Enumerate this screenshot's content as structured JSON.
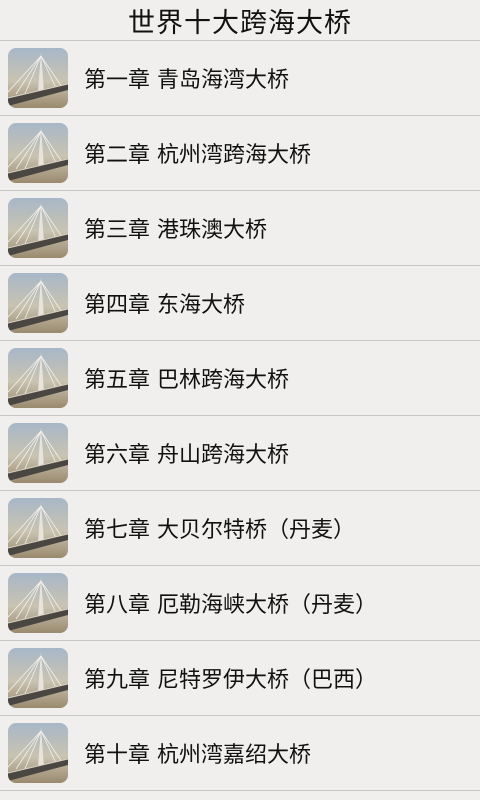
{
  "header": {
    "title": "世界十大跨海大桥"
  },
  "chapters": [
    {
      "label": "第一章 青岛海湾大桥",
      "icon": "bridge-thumbnail-icon"
    },
    {
      "label": "第二章 杭州湾跨海大桥",
      "icon": "bridge-thumbnail-icon"
    },
    {
      "label": "第三章 港珠澳大桥",
      "icon": "bridge-thumbnail-icon"
    },
    {
      "label": "第四章 东海大桥",
      "icon": "bridge-thumbnail-icon"
    },
    {
      "label": "第五章 巴林跨海大桥",
      "icon": "bridge-thumbnail-icon"
    },
    {
      "label": "第六章 舟山跨海大桥",
      "icon": "bridge-thumbnail-icon"
    },
    {
      "label": "第七章 大贝尔特桥（丹麦）",
      "icon": "bridge-thumbnail-icon"
    },
    {
      "label": "第八章 厄勒海峡大桥（丹麦）",
      "icon": "bridge-thumbnail-icon"
    },
    {
      "label": "第九章 尼特罗伊大桥（巴西）",
      "icon": "bridge-thumbnail-icon"
    },
    {
      "label": "第十章 杭州湾嘉绍大桥",
      "icon": "bridge-thumbnail-icon"
    }
  ],
  "colors": {
    "background": "#f0efed",
    "divider": "#c9c7c3",
    "text": "#111111"
  }
}
